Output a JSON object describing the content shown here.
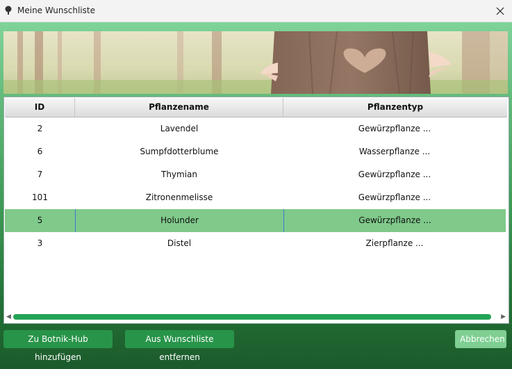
{
  "window": {
    "title": "Meine Wunschliste",
    "icon": "tree-icon",
    "close_icon": "close-icon"
  },
  "table": {
    "headers": [
      "ID",
      "Pflanzename",
      "Pflanzentyp"
    ],
    "rows": [
      [
        "2",
        "Lavendel",
        "Gewürzpflanze ..."
      ],
      [
        "6",
        "Sumpfdotterblume",
        "Wasserpflanze ..."
      ],
      [
        "7",
        "Thymian",
        "Gewürzpflanze ..."
      ],
      [
        "101",
        "Zitronenmelisse",
        "Gewürzpflanze ..."
      ],
      [
        "5",
        "Holunder",
        "Gewürzpflanze ..."
      ],
      [
        "3",
        "Distel",
        "Zierpflanze ..."
      ]
    ],
    "selected_row": 4,
    "selected_color": "#7fc98a"
  },
  "buttons": {
    "add": "Zu Botnik-Hub hinzufügen",
    "remove": "Aus Wunschliste entfernen",
    "cancel": "Abbrechen"
  },
  "colors": {
    "accent": "#28944a",
    "scrollbar": "#23a455"
  }
}
